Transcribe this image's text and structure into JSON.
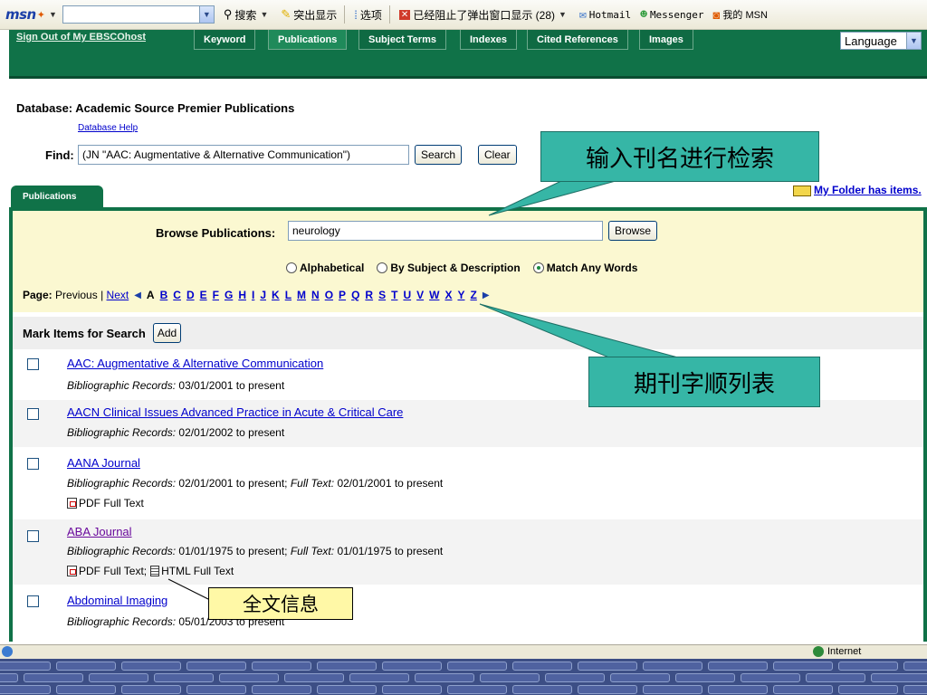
{
  "msn_toolbar": {
    "logo": "msn",
    "search_label": "搜索",
    "highlight_label": "突出显示",
    "options_label": "选项",
    "popup_blocked_label": "已经阻止了弹出窗口显示 (28)",
    "hotmail_label": "Hotmail",
    "messenger_label": "Messenger",
    "my_msn_label": "我的 MSN"
  },
  "header": {
    "signout": "Sign Out of My EBSCOhost",
    "tabs": [
      "Keyword",
      "Publications",
      "Subject Terms",
      "Indexes",
      "Cited References",
      "Images"
    ],
    "active_tab": "Publications",
    "language_label": "Language"
  },
  "database": {
    "label": "Database:",
    "name": "Academic Source Premier Publications",
    "help_link": "Database Help"
  },
  "find": {
    "label": "Find:",
    "value": "(JN \"AAC: Augmentative & Alternative Communication\")",
    "search_button": "Search",
    "clear_button": "Clear"
  },
  "callouts": {
    "search_by_title": "输入刊名进行检索",
    "journal_alpha_list": "期刊字顺列表",
    "fulltext_info": "全文信息"
  },
  "publications_tab": "Publications",
  "folder_link": "My Folder has items.",
  "browse": {
    "label": "Browse Publications:",
    "value": "neurology",
    "button": "Browse",
    "options": [
      "Alphabetical",
      "By Subject & Description",
      "Match Any Words"
    ],
    "selected_option": "Match Any Words"
  },
  "pagination": {
    "page_label": "Page:",
    "previous_label": "Previous",
    "separator": "|",
    "next_label": "Next",
    "first_letter": "A",
    "letters": [
      "B",
      "C",
      "D",
      "E",
      "F",
      "G",
      "H",
      "I",
      "J",
      "K",
      "L",
      "M",
      "N",
      "O",
      "P",
      "Q",
      "R",
      "S",
      "T",
      "U",
      "V",
      "W",
      "X",
      "Y",
      "Z"
    ]
  },
  "mark_items": {
    "label": "Mark Items for Search",
    "add_button": "Add"
  },
  "results": [
    {
      "title": "AAC: Augmentative & Alternative Communication",
      "records_label": "Bibliographic Records:",
      "records": "03/01/2001 to present"
    },
    {
      "title": "AACN Clinical Issues Advanced Practice in Acute & Critical Care",
      "records_label": "Bibliographic Records:",
      "records": "02/01/2002 to present"
    },
    {
      "title": "AANA Journal",
      "records_label": "Bibliographic Records:",
      "records": "02/01/2001 to present;",
      "fulltext_label": "Full Text:",
      "fulltext": "02/01/2001 to present",
      "pdf_label": "PDF Full Text"
    },
    {
      "title": "ABA Journal",
      "records_label": "Bibliographic Records:",
      "records": "01/01/1975 to present;",
      "fulltext_label": "Full Text:",
      "fulltext": "01/01/1975 to present",
      "pdf_label": "PDF Full Text;",
      "html_label": "HTML Full Text"
    },
    {
      "title": "Abdominal Imaging",
      "records_label": "Bibliographic Records:",
      "records": "05/01/2003 to present"
    }
  ],
  "statusbar": {
    "zone": "Internet"
  },
  "colors": {
    "ebsco_green": "#107248",
    "browse_bg": "#fbf8d1",
    "callout_teal": "#36b6a6",
    "callout_yellow": "#fff8a6",
    "link_blue": "#0000cc",
    "visited_purple": "#6a0a9c"
  }
}
